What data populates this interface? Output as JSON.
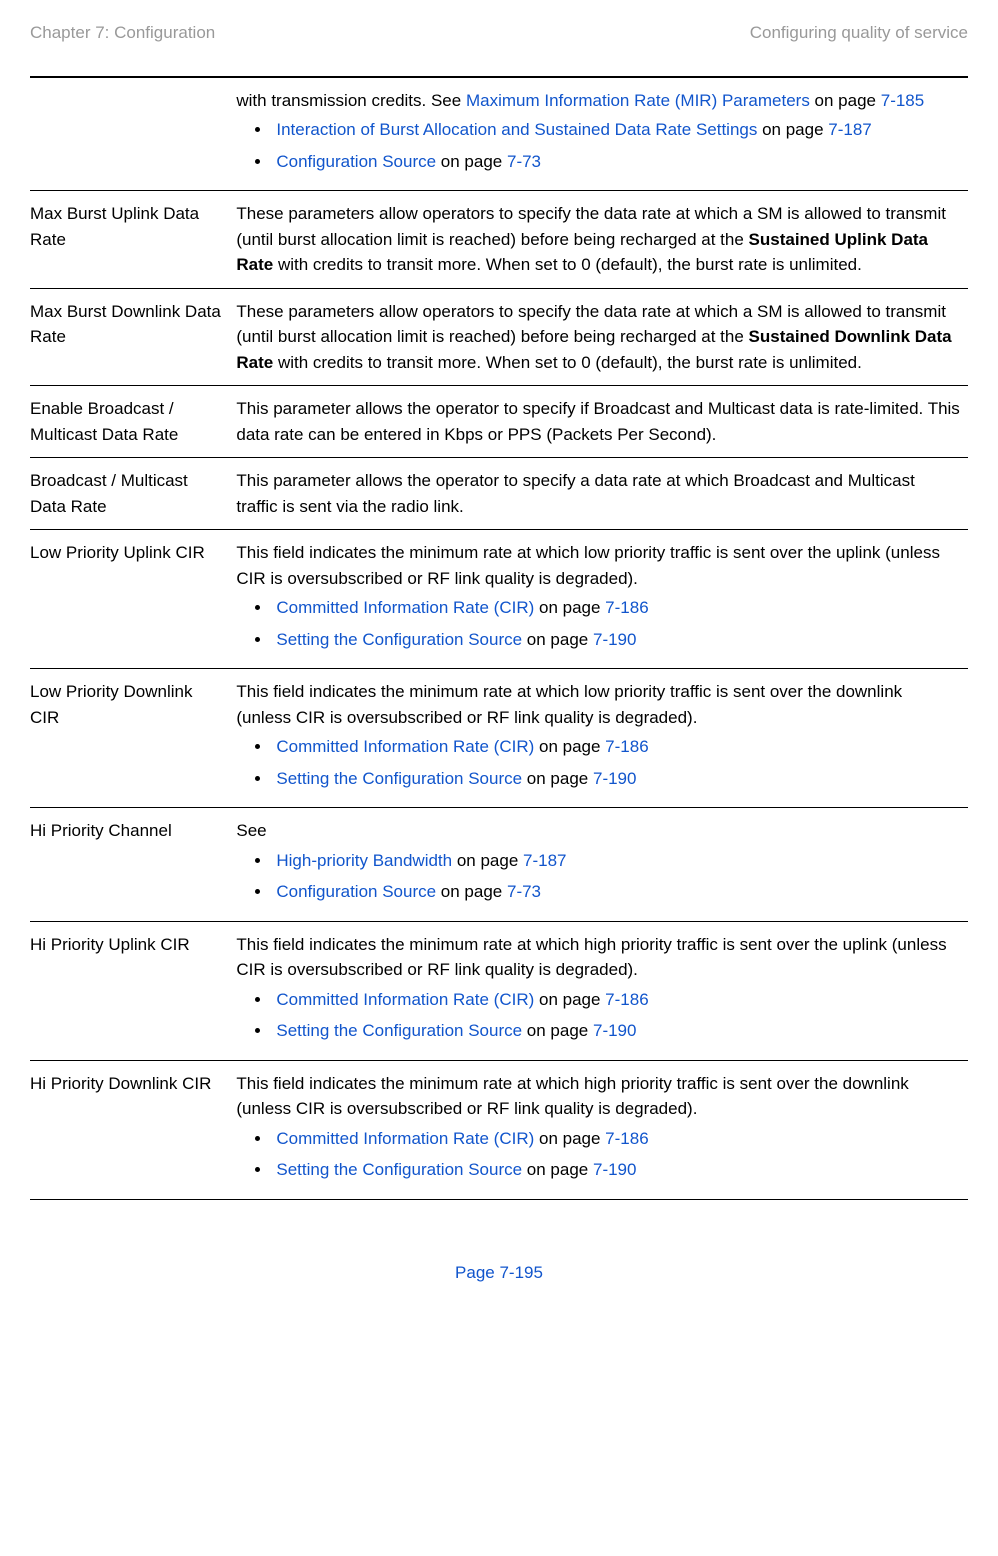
{
  "header": {
    "left": "Chapter 7:  Configuration",
    "right": "Configuring quality of service"
  },
  "rows": {
    "r1": {
      "label": "",
      "pre_text": "with transmission credits. See ",
      "link1": "Maximum Information Rate (MIR) Parameters",
      "post1": " on page ",
      "page1": "7-185",
      "b1_link": "Interaction of Burst Allocation and Sustained Data Rate Settings",
      "b1_post": " on page ",
      "b1_page": "7-187",
      "b2_link": "Configuration Source",
      "b2_post": " on page ",
      "b2_page": "7-73"
    },
    "r2": {
      "label": "Max Burst Uplink Data Rate",
      "t1": "These parameters allow operators to specify the data rate at which a SM is allowed to transmit (until burst allocation limit is reached) before being recharged at the ",
      "bold": "Sustained Uplink Data Rate",
      "t2": " with credits to transit more. When set to 0 (default), the burst rate is unlimited."
    },
    "r3": {
      "label": "Max Burst Downlink Data Rate",
      "t1": "These parameters allow operators to specify the data rate at which a SM is allowed to transmit (until burst allocation limit is reached) before being recharged at the ",
      "bold": "Sustained Downlink Data Rate",
      "t2": " with credits to transit more. When set to 0 (default), the burst rate is unlimited."
    },
    "r4": {
      "label": "Enable Broadcast / Multicast Data Rate",
      "t1": "This parameter allows the operator to specify if Broadcast and Multicast data is rate-limited. This data rate can be entered in Kbps or PPS (Packets Per Second)."
    },
    "r5": {
      "label": "Broadcast / Multicast Data Rate",
      "t1": "This parameter allows the operator to specify a data rate at which Broadcast and Multicast traffic is sent via the radio link."
    },
    "r6": {
      "label": "Low Priority Uplink CIR",
      "t1": "This field indicates the minimum rate at which low priority traffic is sent over the uplink (unless CIR is oversubscribed or RF link quality is degraded).",
      "b1_link": " Committed Information Rate (CIR)",
      "b1_post": " on page ",
      "b1_page": "7-186",
      "b2_link": "Setting the Configuration Source",
      "b2_post": " on page ",
      "b2_page": "7-190"
    },
    "r7": {
      "label": "Low Priority Downlink CIR",
      "t1": "This field indicates the minimum rate at which low priority traffic is sent over the downlink (unless CIR is oversubscribed or RF link quality is degraded).",
      "b1_link": "Committed Information Rate (CIR)",
      "b1_post": " on page ",
      "b1_page": "7-186",
      "b2_link": "Setting the Configuration Source",
      "b2_post": " on page ",
      "b2_page": "7-190"
    },
    "r8": {
      "label": "Hi Priority Channel",
      "t1": "See",
      "b1_link": "High-priority Bandwidth",
      "b1_post": " on page ",
      "b1_page": "7-187",
      "b2_link": "Configuration Source",
      "b2_post": " on page ",
      "b2_page": "7-73"
    },
    "r9": {
      "label": "Hi Priority Uplink CIR",
      "t1": "This field indicates the minimum rate at which high priority traffic is sent over the uplink (unless CIR is oversubscribed or RF link quality is degraded).",
      "b1_link": "Committed Information Rate (CIR)",
      "b1_post": " on page ",
      "b1_page": "7-186",
      "b2_link": "Setting the Configuration Source",
      "b2_post": " on page ",
      "b2_page": "7-190"
    },
    "r10": {
      "label": "Hi Priority Downlink CIR",
      "t1": "This field indicates the minimum rate at which high priority traffic is sent over the downlink (unless CIR is oversubscribed or RF link quality is degraded).",
      "b1_link": "Committed Information Rate (CIR)",
      "b1_post": " on page ",
      "b1_page": "7-186",
      "b2_link": "Setting the Configuration Source",
      "b2_post": " on page ",
      "b2_page": "7-190"
    }
  },
  "footer": "Page 7-195"
}
